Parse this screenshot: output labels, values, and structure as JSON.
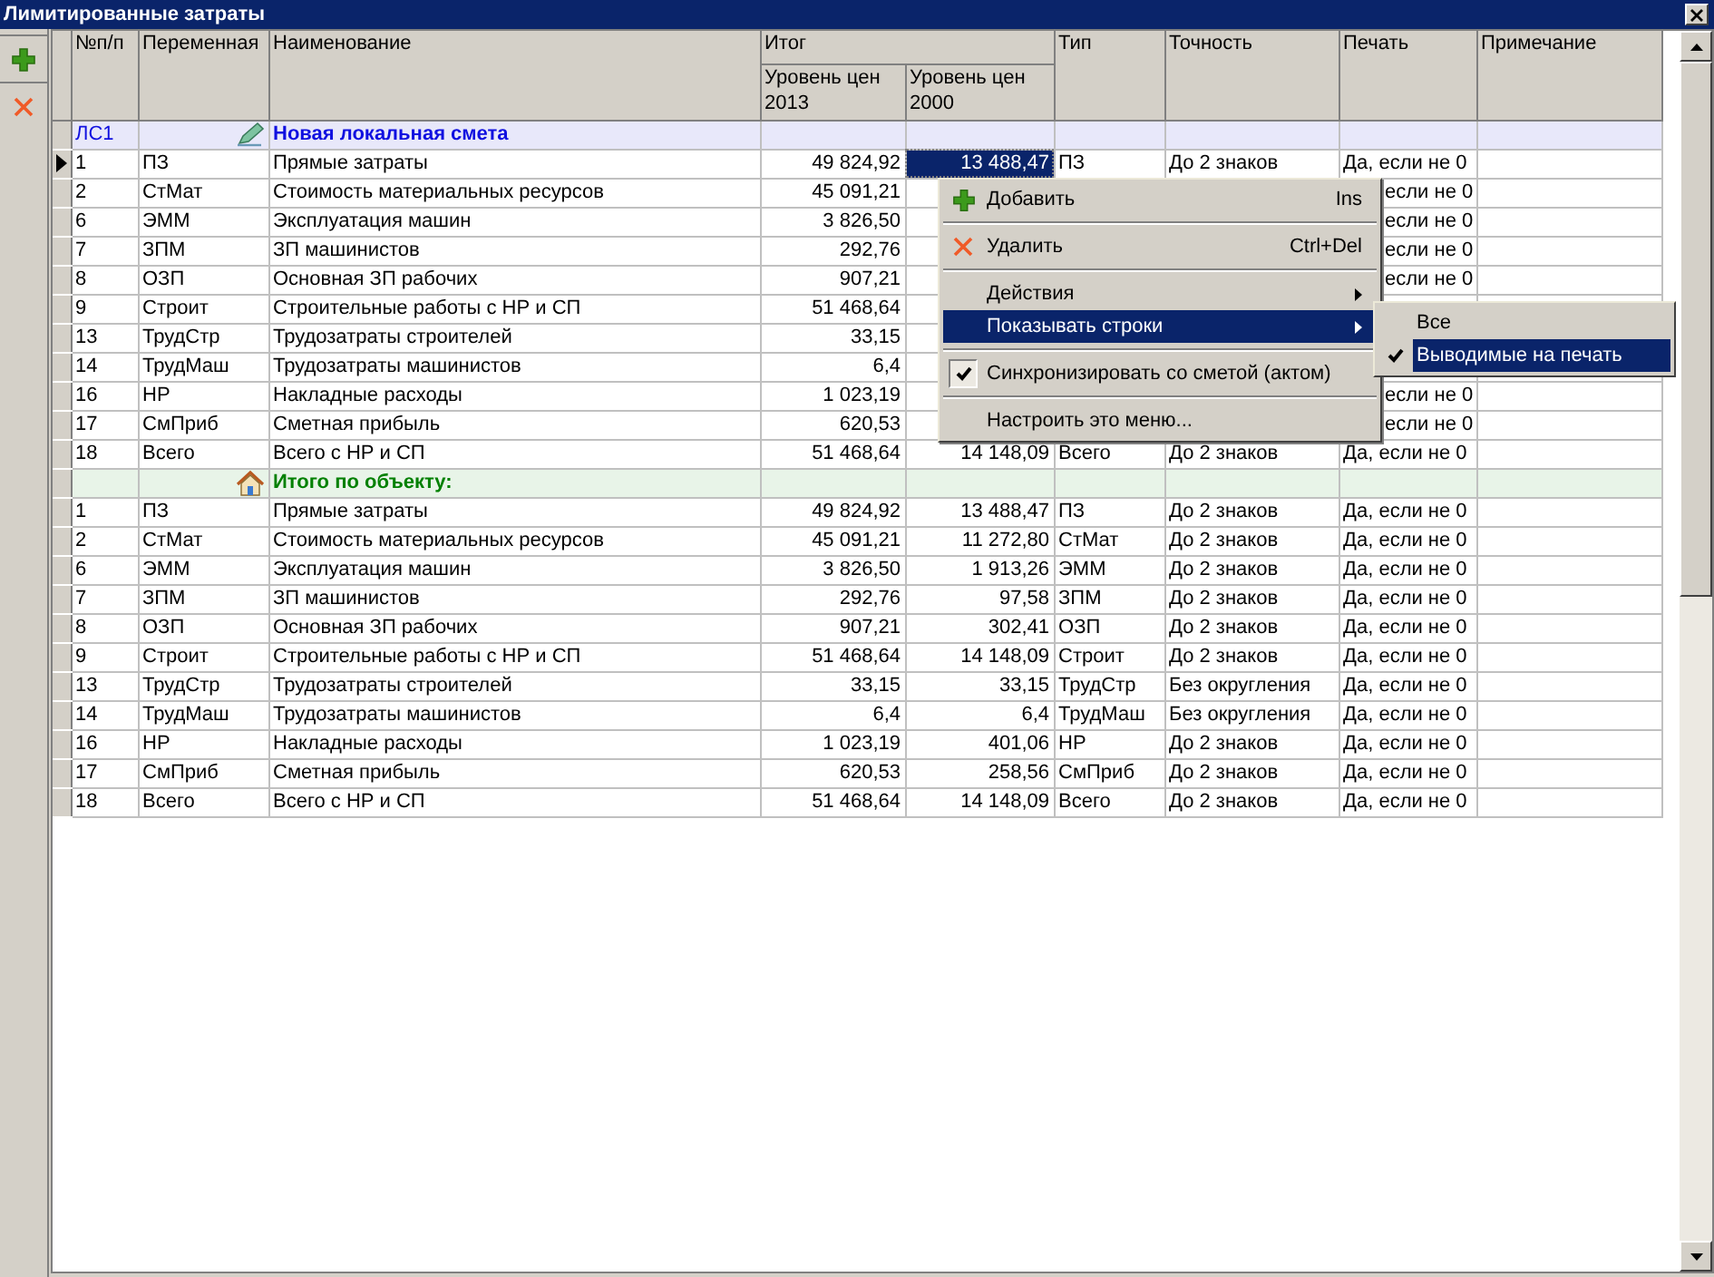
{
  "window": {
    "title": "Лимитированные затраты"
  },
  "table": {
    "group_header": "Итог",
    "columns": [
      {
        "label": "№п/п"
      },
      {
        "label": "Переменная"
      },
      {
        "label": "Наименование"
      },
      {
        "label": "Уровень цен 2013"
      },
      {
        "label": "Уровень цен 2000"
      },
      {
        "label": "Тип"
      },
      {
        "label": "Точность"
      },
      {
        "label": "Печать"
      },
      {
        "label": "Примечание"
      }
    ],
    "groups": [
      {
        "kind": "smeta",
        "code": "ЛС1",
        "title": "Новая локальная смета",
        "rows": [
          {
            "n": "1",
            "var": "ПЗ",
            "name": "Прямые затраты",
            "v2013": "49 824,92",
            "v2000": "13 488,47",
            "tip": "ПЗ",
            "tochnost": "До 2 знаков",
            "pechat": "Да, если не 0",
            "current": true,
            "cell_selected": true,
            "under_menu": false
          },
          {
            "n": "2",
            "var": "СтМат",
            "name": "Стоимость материальных ресурсов",
            "v2013": "45 091,21",
            "pechat": "если не 0",
            "current": false,
            "under_menu": true
          },
          {
            "n": "6",
            "var": "ЭММ",
            "name": "Эксплуатация машин",
            "v2013": "3 826,50",
            "pechat": "если не 0",
            "current": false,
            "under_menu": true
          },
          {
            "n": "7",
            "var": "ЗПМ",
            "name": "ЗП машинистов",
            "v2013": "292,76",
            "pechat": "если не 0",
            "current": false,
            "under_menu": true
          },
          {
            "n": "8",
            "var": "ОЗП",
            "name": "Основная ЗП рабочих",
            "v2013": "907,21",
            "pechat": "если не 0",
            "current": false,
            "under_menu": true
          },
          {
            "n": "9",
            "var": "Строит",
            "name": "Строительные работы с НР и СП",
            "v2013": "51 468,64",
            "current": false
          },
          {
            "n": "13",
            "var": "ТрудСтр",
            "name": "Трудозатраты строителей",
            "v2013": "33,15",
            "current": false
          },
          {
            "n": "14",
            "var": "ТрудМаш",
            "name": "Трудозатраты машинистов",
            "v2013": "6,4",
            "current": false
          },
          {
            "n": "16",
            "var": "НР",
            "name": "Накладные расходы",
            "v2013": "1 023,19",
            "pechat": "если не 0",
            "current": false,
            "under_menu": true
          },
          {
            "n": "17",
            "var": "СмПриб",
            "name": "Сметная прибыль",
            "v2013": "620,53",
            "pechat": "если не 0",
            "current": false,
            "under_menu": true
          },
          {
            "n": "18",
            "var": "Всего",
            "name": "Всего с НР и СП",
            "v2013": "51 468,64",
            "v2000": "14 148,09",
            "tip": "Всего",
            "tochnost": "До 2 знаков",
            "pechat": "Да, если не 0",
            "current": false,
            "cell_selected": false,
            "under_menu": false
          }
        ]
      },
      {
        "kind": "object",
        "title": "Итого по объекту:",
        "rows": [
          {
            "n": "1",
            "var": "ПЗ",
            "name": "Прямые затраты",
            "v2013": "49 824,92",
            "v2000": "13 488,47",
            "tip": "ПЗ",
            "tochnost": "До 2 знаков",
            "pechat": "Да, если не 0",
            "current": false,
            "cell_selected": false,
            "under_menu": false
          },
          {
            "n": "2",
            "var": "СтМат",
            "name": "Стоимость материальных ресурсов",
            "v2013": "45 091,21",
            "v2000": "11 272,80",
            "tip": "СтМат",
            "tochnost": "До 2 знаков",
            "pechat": "Да, если не 0",
            "current": false,
            "cell_selected": false,
            "under_menu": false
          },
          {
            "n": "6",
            "var": "ЭММ",
            "name": "Эксплуатация машин",
            "v2013": "3 826,50",
            "v2000": "1 913,26",
            "tip": "ЭММ",
            "tochnost": "До 2 знаков",
            "pechat": "Да, если не 0",
            "current": false,
            "cell_selected": false,
            "under_menu": false
          },
          {
            "n": "7",
            "var": "ЗПМ",
            "name": "ЗП машинистов",
            "v2013": "292,76",
            "v2000": "97,58",
            "tip": "ЗПМ",
            "tochnost": "До 2 знаков",
            "pechat": "Да, если не 0",
            "current": false,
            "cell_selected": false,
            "under_menu": false
          },
          {
            "n": "8",
            "var": "ОЗП",
            "name": "Основная ЗП рабочих",
            "v2013": "907,21",
            "v2000": "302,41",
            "tip": "ОЗП",
            "tochnost": "До 2 знаков",
            "pechat": "Да, если не 0",
            "current": false,
            "cell_selected": false,
            "under_menu": false
          },
          {
            "n": "9",
            "var": "Строит",
            "name": "Строительные работы с НР и СП",
            "v2013": "51 468,64",
            "v2000": "14 148,09",
            "tip": "Строит",
            "tochnost": "До 2 знаков",
            "pechat": "Да, если не 0",
            "current": false,
            "cell_selected": false,
            "under_menu": false
          },
          {
            "n": "13",
            "var": "ТрудСтр",
            "name": "Трудозатраты строителей",
            "v2013": "33,15",
            "v2000": "33,15",
            "tip": "ТрудСтр",
            "tochnost": "Без округления",
            "pechat": "Да, если не 0",
            "current": false,
            "cell_selected": false,
            "under_menu": false
          },
          {
            "n": "14",
            "var": "ТрудМаш",
            "name": "Трудозатраты машинистов",
            "v2013": "6,4",
            "v2000": "6,4",
            "tip": "ТрудМаш",
            "tochnost": "Без округления",
            "pechat": "Да, если не 0",
            "current": false,
            "cell_selected": false,
            "under_menu": false
          },
          {
            "n": "16",
            "var": "НР",
            "name": "Накладные расходы",
            "v2013": "1 023,19",
            "v2000": "401,06",
            "tip": "НР",
            "tochnost": "До 2 знаков",
            "pechat": "Да, если не 0",
            "current": false,
            "cell_selected": false,
            "under_menu": false
          },
          {
            "n": "17",
            "var": "СмПриб",
            "name": "Сметная прибыль",
            "v2013": "620,53",
            "v2000": "258,56",
            "tip": "СмПриб",
            "tochnost": "До 2 знаков",
            "pechat": "Да, если не 0",
            "current": false,
            "cell_selected": false,
            "under_menu": false
          },
          {
            "n": "18",
            "var": "Всего",
            "name": "Всего с НР и СП",
            "v2013": "51 468,64",
            "v2000": "14 148,09",
            "tip": "Всего",
            "tochnost": "До 2 знаков",
            "pechat": "Да, если не 0",
            "current": false,
            "cell_selected": false,
            "under_menu": false
          }
        ]
      }
    ]
  },
  "context_menu": {
    "items": [
      {
        "kind": "add",
        "label": "Добавить",
        "shortcut": "Ins",
        "selected": false,
        "submenu": false
      },
      {
        "kind": "separator"
      },
      {
        "kind": "delete",
        "label": "Удалить",
        "shortcut": "Ctrl+Del",
        "selected": false,
        "submenu": false
      },
      {
        "kind": "separator"
      },
      {
        "kind": "item",
        "label": "Действия",
        "selected": false,
        "submenu": true
      },
      {
        "kind": "item",
        "label": "Показывать строки",
        "selected": true,
        "submenu": true
      },
      {
        "kind": "separator"
      },
      {
        "kind": "item",
        "label": "Синхронизировать со сметой (актом)",
        "checked": true,
        "selected": false,
        "submenu": false
      },
      {
        "kind": "separator"
      },
      {
        "kind": "item",
        "label": "Настроить это меню...",
        "selected": false,
        "submenu": false
      }
    ]
  },
  "submenu": {
    "items": [
      {
        "label": "Все",
        "checked": false,
        "selected": false
      },
      {
        "label": "Выводимые на печать",
        "checked": true,
        "selected": true
      }
    ]
  }
}
